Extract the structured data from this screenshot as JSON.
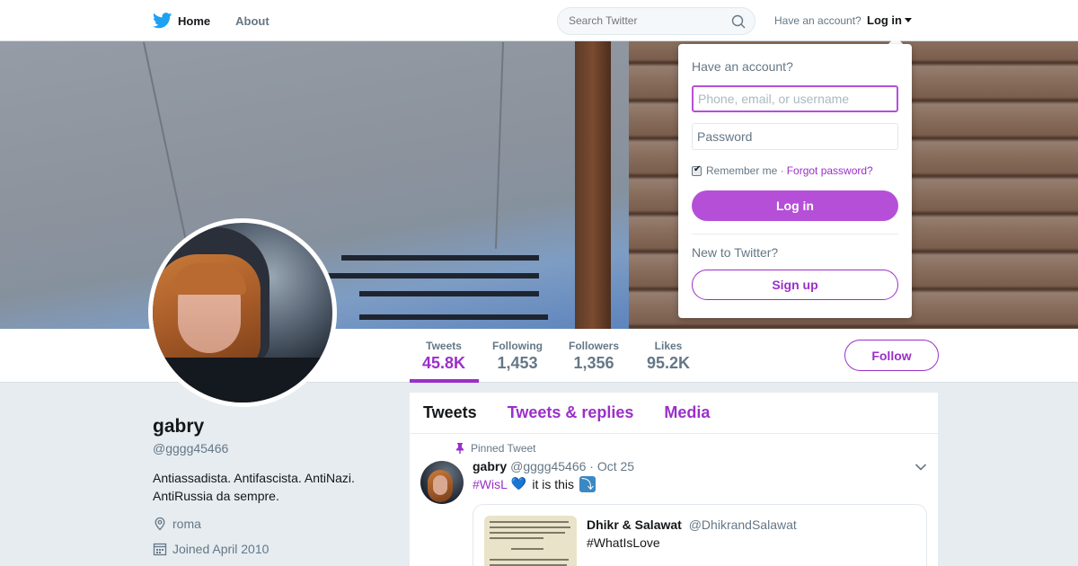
{
  "topbar": {
    "nav": [
      {
        "label": "Home",
        "icon": "twitter-bird-icon"
      },
      {
        "label": "About"
      }
    ],
    "search_placeholder": "Search Twitter",
    "have_account": "Have an account?",
    "login_label": "Log in"
  },
  "profile": {
    "name": "gabry",
    "handle": "@gggg45466",
    "bio_line1": "Antiassadista. Antifascista. AntiNazi.",
    "bio_line2": "AntiRussia da sempre.",
    "location": "roma",
    "joined": "Joined April 2010"
  },
  "stats": [
    {
      "label": "Tweets",
      "value": "45.8K",
      "active": true
    },
    {
      "label": "Following",
      "value": "1,453"
    },
    {
      "label": "Followers",
      "value": "1,356"
    },
    {
      "label": "Likes",
      "value": "95.2K"
    }
  ],
  "follow_label": "Follow",
  "tabs": [
    "Tweets",
    "Tweets & replies",
    "Media"
  ],
  "tweet": {
    "pinned_label": "Pinned Tweet",
    "author": "gabry",
    "meta": "@gggg45466 · Oct 25",
    "hashtag": "#WisL",
    "heart": "💙",
    "text": "it is this",
    "quote": {
      "author": "Dhikr & Salawat",
      "handle": "@DhikrandSalawat",
      "text": "#WhatIsLove"
    }
  },
  "login_dropdown": {
    "title": "Have an account?",
    "username_placeholder": "Phone, email, or username",
    "password_placeholder": "Password",
    "remember_label": "Remember me ·",
    "forgot_label": "Forgot password?",
    "login_button": "Log in",
    "new_label": "New to Twitter?",
    "signup_button": "Sign up"
  },
  "colors": {
    "accent": "#9b2fc9",
    "accent_button": "#b54fd8",
    "page_bg": "#e6ecf0",
    "muted_text": "#657786"
  }
}
